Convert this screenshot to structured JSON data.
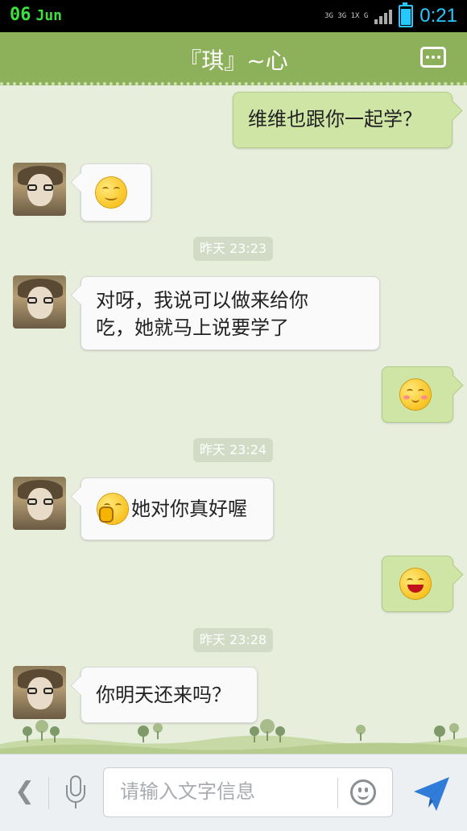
{
  "status_bar": {
    "date_day": "06",
    "date_month": "Jun",
    "network_top": "3G 3G 1X G",
    "time": "0:21"
  },
  "header": {
    "title": "『琪』~心",
    "menu_icon": "more-dots-icon"
  },
  "messages": [
    {
      "side": "out",
      "text": "维维也跟你一起学？"
    },
    {
      "side": "in",
      "emoji": "smile-emoji"
    },
    {
      "type": "time",
      "text": "昨天 23:23"
    },
    {
      "side": "in",
      "line1": "对呀，我说可以做来给你",
      "line2": "吃，她就马上说要学了"
    },
    {
      "side": "out",
      "emoji": "blush-emoji"
    },
    {
      "type": "time",
      "text": "昨天 23:24"
    },
    {
      "side": "in",
      "emoji": "shy-emoji",
      "text": "她对你真好喔"
    },
    {
      "side": "out",
      "emoji": "laugh-emoji"
    },
    {
      "type": "time",
      "text": "昨天 23:28"
    },
    {
      "side": "in",
      "text": "你明天还来吗？"
    }
  ],
  "input_bar": {
    "placeholder": "请输入文字信息",
    "icons": [
      "back-chevron-icon",
      "microphone-icon",
      "emoji-icon",
      "send-icon"
    ]
  },
  "colors": {
    "header": "#8db05b",
    "background": "#e7eedc",
    "outgoing_bubble": "#cfe5a6",
    "incoming_bubble": "#fafafa"
  }
}
